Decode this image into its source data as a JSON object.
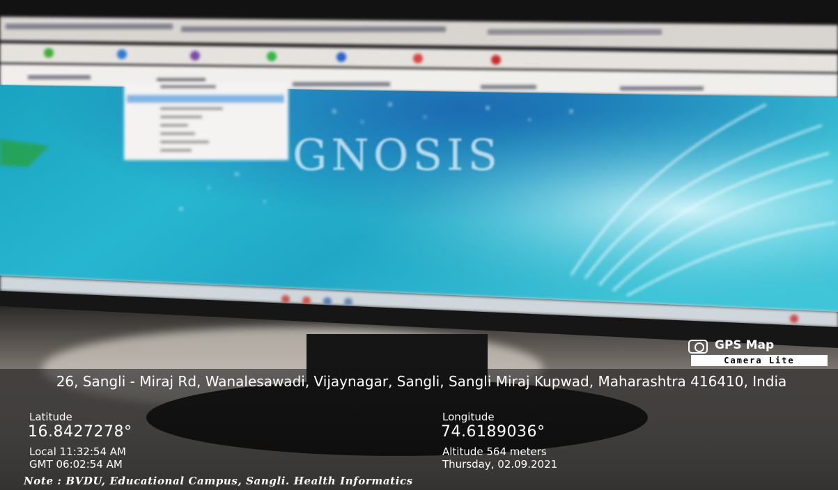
{
  "photo": {
    "subject": "monitor-photo",
    "screen_logo_text": "GNOSIS",
    "colors": {
      "screen_teal": "#1fb9c8",
      "screen_blue": "#1a6fa3",
      "bezel": "#101010",
      "desk": "#b8b4ae"
    }
  },
  "overlay": {
    "badge": {
      "title": "GPS Map",
      "subtitle": "Camera Lite",
      "icon": "camera-icon"
    },
    "address": "26, Sangli - Miraj Rd, Wanalesawadi, Vijaynagar, Sangli, Sangli Miraj Kupwad, Maharashtra 416410, India",
    "latitude": {
      "label": "Latitude",
      "value": "16.8427278°"
    },
    "longitude": {
      "label": "Longitude",
      "value": "74.6189036°"
    },
    "local_time": "Local 11:32:54 AM",
    "gmt_time": "GMT 06:02:54 AM",
    "altitude": "Altitude 564 meters",
    "date": "Thursday, 02.09.2021",
    "note": "Note : BVDU, Educational Campus, Sangli. Health Informatics"
  }
}
